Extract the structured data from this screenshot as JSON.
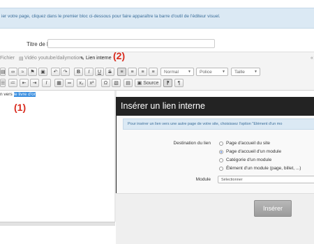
{
  "banner": {
    "text": "ier votre page, cliquez dans le premier bloc ci-dessous pour faire apparaître la barre d'outil de l'éditeur visuel."
  },
  "title_field": {
    "label": "Titre de la ligne",
    "value": ""
  },
  "plugin_bar": {
    "file": "Fichier",
    "video": "Vidéo youtube/dailymotion",
    "internal_link": "Lien interne"
  },
  "toolbar": {
    "format_select": "Normal",
    "font_select": "Police",
    "size_select": "Taille",
    "source_label": "Source"
  },
  "editor": {
    "text_before": "n vers ",
    "text_selected": "le livre d'or"
  },
  "callouts": {
    "one": "(1)",
    "two": "(2)"
  },
  "modal": {
    "title": "Insérer un lien interne",
    "info": "Pour insérer un lien vers une autre page de votre site, choisissez l'option \"Elément d'un mo",
    "destination_label": "Destination du lien",
    "options": [
      {
        "label": "Page d'accueil du site",
        "checked": false
      },
      {
        "label": "Page d'accueil d'un module",
        "checked": true
      },
      {
        "label": "Catégorie d'un module",
        "checked": false
      },
      {
        "label": "Élément d'un module (page, billet, ...)",
        "checked": false
      }
    ],
    "module_label": "Module",
    "module_placeholder": "Sélectionner",
    "insert_label": "Insérer"
  },
  "colors": {
    "accent_red": "#d92b1e",
    "banner_bg": "#dbe9f4",
    "modal_header_bg": "#232323",
    "selection": "#3b8fe0"
  }
}
